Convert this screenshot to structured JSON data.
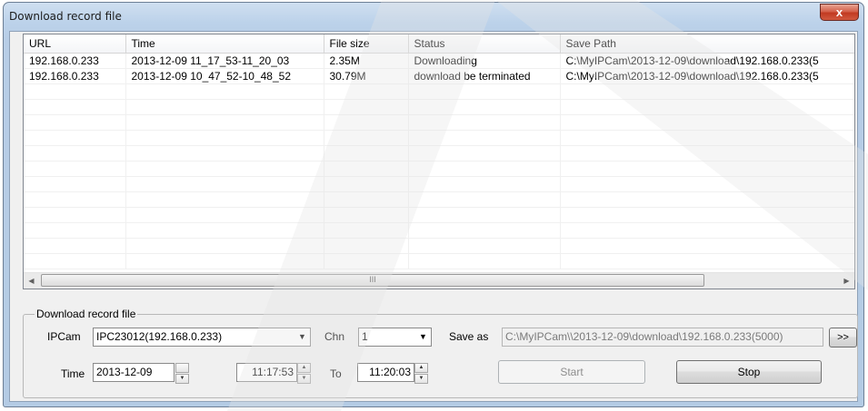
{
  "window": {
    "title": "Download record file",
    "close_label": "x"
  },
  "list": {
    "columns": [
      "URL",
      "Time",
      "File size",
      "Status",
      "Save Path"
    ],
    "rows": [
      [
        "192.168.0.233",
        "2013-12-09 11_17_53-11_20_03",
        "2.35M",
        "Downloading",
        "C:\\MyIPCam\\2013-12-09\\download\\192.168.0.233(5"
      ],
      [
        "192.168.0.233",
        "2013-12-09 10_47_52-10_48_52",
        "30.79M",
        "download be terminated",
        "C:\\MyIPCam\\2013-12-09\\download\\192.168.0.233(5"
      ]
    ],
    "scroll_grip": "III"
  },
  "form": {
    "group_title": "Download record file",
    "ipcam_label": "IPCam",
    "ipcam_value": "IPC23012(192.168.0.233)",
    "chn_label": "Chn",
    "chn_value": "1",
    "saveas_label": "Save as",
    "saveas_value": "C:\\MyIPCam\\\\2013-12-09\\download\\192.168.0.233(5000)",
    "browse_label": ">>",
    "time_label": "Time",
    "date_value": "2013-12-09",
    "start_time": "11:17:53",
    "to_label": "To",
    "end_time": "11:20:03",
    "start_label": "Start",
    "stop_label": "Stop"
  },
  "colors": {
    "title_bar": "#bcd2ea",
    "close_button": "#c13a22",
    "client_bg": "#f0f0f0"
  }
}
